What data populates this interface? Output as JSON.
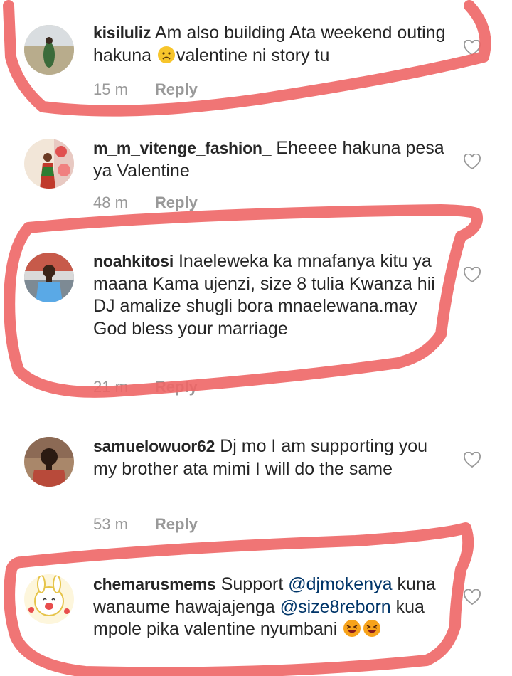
{
  "comments": [
    {
      "username": "kisiluliz",
      "text_a": "Am also building Ata weekend outing hakuna ",
      "emoji": "sad-face-emoji",
      "text_b": "valentine ni story tu",
      "time": "15 m",
      "reply": "Reply"
    },
    {
      "username": "m_m_vitenge_fashion_",
      "text_a": "Eheeee hakuna pesa ya Valentine",
      "time": "48 m",
      "reply": "Reply"
    },
    {
      "username": "noahkitosi",
      "text_a": "Inaeleweka ka mnafanya kitu ya maana Kama ujenzi, size 8 tulia Kwanza hii DJ amalize shugli bora mnaelewana.may God bless your marriage",
      "time": "21 m",
      "reply": "Reply"
    },
    {
      "username": "samuelowuor62",
      "text_a": "Dj mo I am supporting you my brother ata mimi I will do the same",
      "time": "53 m",
      "reply": "Reply"
    },
    {
      "username": "chemarusmems",
      "text_a": "Support ",
      "mention_1": "@djmokenya",
      "text_b": " kuna wanaume hawajajenga ",
      "mention_2": "@size8reborn",
      "text_c": " kua mpole pika valentine nyumbani ",
      "emoji": "laughing-face-emoji"
    }
  ],
  "colors": {
    "username": "#262626",
    "text": "#262626",
    "meta": "#999999",
    "mention": "#003569",
    "annotation": "#ee6666"
  },
  "icons": {
    "like": "heart-outline-icon"
  }
}
